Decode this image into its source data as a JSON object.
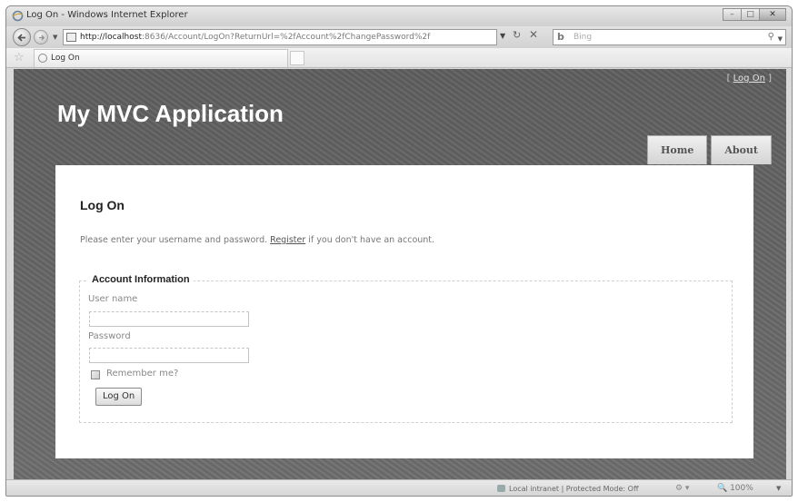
{
  "window": {
    "title": "Log On - Windows Internet Explorer",
    "minimize": "–",
    "maximize": "□",
    "close": "✕"
  },
  "address_bar": {
    "url_host": "http://localhost",
    "url_rest": ":8636/Account/LogOn?ReturnUrl=%2fAccount%2fChangePassword%2f"
  },
  "search": {
    "placeholder": "Bing",
    "provider_icon": "b"
  },
  "tab": {
    "label": "Log On"
  },
  "site": {
    "login_prefix": "[ ",
    "login_link": "Log On",
    "login_suffix": " ]",
    "title": "My MVC Application",
    "menu": [
      {
        "label": "Home"
      },
      {
        "label": "About"
      }
    ]
  },
  "page": {
    "heading": "Log On",
    "instructions_before": "Please enter your username and password. ",
    "register_link": "Register",
    "instructions_after": " if you don't have an account."
  },
  "form": {
    "legend": "Account Information",
    "username_label": "User name",
    "username_value": "",
    "password_label": "Password",
    "password_value": "",
    "remember_label": "Remember me?",
    "remember_checked": false,
    "submit_label": "Log On"
  },
  "statusbar": {
    "zone": "Local intranet | Protected Mode: Off",
    "zoom": "100%"
  },
  "icons": [
    "ie-icon",
    "back-arrow-icon",
    "forward-arrow-icon",
    "page-icon",
    "refresh-icon",
    "stop-icon",
    "search-icon",
    "favorites-star-icon",
    "intranet-zone-icon"
  ]
}
